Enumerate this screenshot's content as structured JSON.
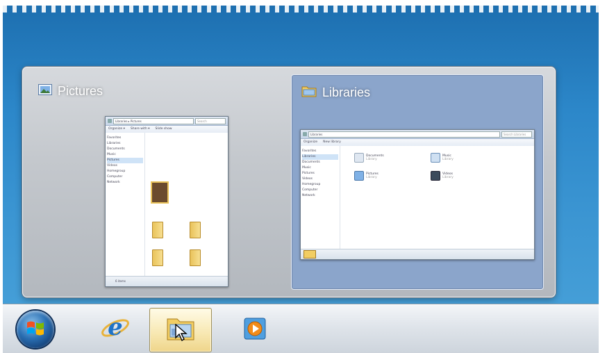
{
  "window_previews": [
    {
      "title": "Pictures",
      "icon": "pictures-library-icon"
    },
    {
      "title": "Libraries",
      "icon": "libraries-folder-icon"
    }
  ],
  "pictures_thumbnail": {
    "nav": [
      "Favorites",
      "Libraries",
      "Documents",
      "Music",
      "Pictures",
      "Videos",
      "Homegroup",
      "Computer",
      "Network"
    ],
    "status": "6 items"
  },
  "libraries_thumbnail": {
    "address": "Libraries",
    "search_placeholder": "Search Libraries",
    "commands": [
      "Organize",
      "New library"
    ],
    "nav": [
      "Favorites",
      "Libraries",
      "Documents",
      "Music",
      "Pictures",
      "Videos",
      "Homegroup",
      "Computer",
      "Network"
    ],
    "items": [
      {
        "name": "Documents",
        "sub": "Library"
      },
      {
        "name": "Music",
        "sub": "Library"
      },
      {
        "name": "Pictures",
        "sub": "Library"
      },
      {
        "name": "Videos",
        "sub": "Library"
      }
    ]
  },
  "taskbar": {
    "buttons": [
      {
        "name": "start-button",
        "icon": "windows-orb-icon"
      },
      {
        "name": "internet-explorer",
        "icon": "internet-explorer-icon"
      },
      {
        "name": "windows-explorer",
        "icon": "explorer-folder-icon",
        "active": true
      },
      {
        "name": "windows-media-player",
        "icon": "media-player-icon"
      }
    ]
  },
  "colors": {
    "accent": "#2a6fb3",
    "active_thumb": "#8ba5cb",
    "active_taskbar": "#f7e7b0"
  }
}
